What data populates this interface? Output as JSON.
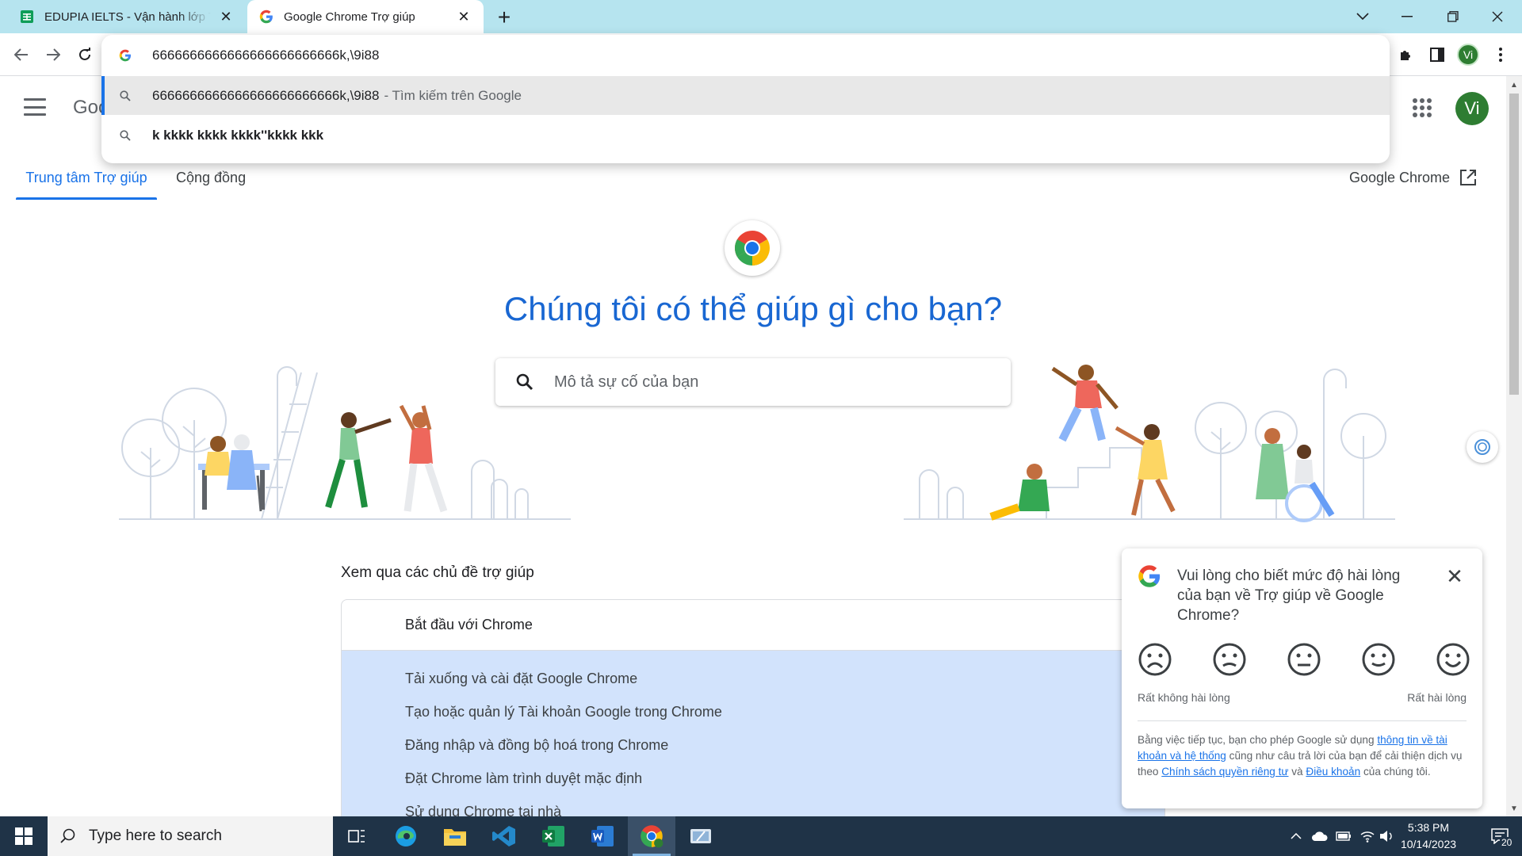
{
  "tabs": [
    {
      "title": "EDUPIA IELTS - Vận hành lớp Test",
      "favicon": "sheets-icon",
      "active": false
    },
    {
      "title": "Google Chrome Trợ giúp",
      "favicon": "google-icon",
      "active": true
    }
  ],
  "omnibox": {
    "value": "6666666666666666666666666k,\\9i88",
    "suggestions": [
      {
        "text": "6666666666666666666666666k,\\9i88",
        "hint": "- Tìm kiếm trên Google",
        "selected": true
      },
      {
        "text": "k kkkk kkkk kkkk''kkkk kkk",
        "hint": "",
        "selected": false
      }
    ]
  },
  "profile": {
    "initials": "Vi"
  },
  "page": {
    "logo_partial": "Goo",
    "tabs": {
      "help_center": "Trung tâm Trợ giúp",
      "community": "Cộng đồng"
    },
    "product_link": "Google Chrome",
    "title": "Chúng tôi có thể giúp gì cho bạn?",
    "search_placeholder": "Mô tả sự cố của bạn",
    "topics_heading": "Xem qua các chủ đề trợ giúp",
    "topic_section": "Bắt đầu với Chrome",
    "topic_items": [
      "Tải xuống và cài đặt Google Chrome",
      "Tạo hoặc quản lý Tài khoản Google trong Chrome",
      "Đăng nhập và đồng bộ hoá trong Chrome",
      "Đặt Chrome làm trình duyệt mặc định",
      "Sử dụng Chrome tại nhà"
    ]
  },
  "survey": {
    "question": "Vui lòng cho biết mức độ hài lòng của bạn về Trợ giúp về Google Chrome?",
    "low_label": "Rất không hài lòng",
    "high_label": "Rất hài lòng",
    "disclaimer_pre": "Bằng việc tiếp tục, bạn cho phép Google sử dụng ",
    "link_account": "thông tin về tài khoản và hệ thống",
    "disclaimer_mid": " cũng như câu trả lời của bạn để cải thiện dịch vụ theo ",
    "link_privacy": "Chính sách quyền riêng tư",
    "disclaimer_and": " và ",
    "link_terms": "Điều khoản",
    "disclaimer_post": " của chúng tôi."
  },
  "taskbar": {
    "search_placeholder": "Type here to search",
    "time": "5:38 PM",
    "date": "10/14/2023",
    "notification_count": "20"
  },
  "colors": {
    "tabstrip": "#b6e4ef",
    "accent": "#1a73e8",
    "title_blue": "#1967d2",
    "topic_bg": "#d2e3fc",
    "taskbar": "#1f3347",
    "avatar": "#2e7d32"
  }
}
